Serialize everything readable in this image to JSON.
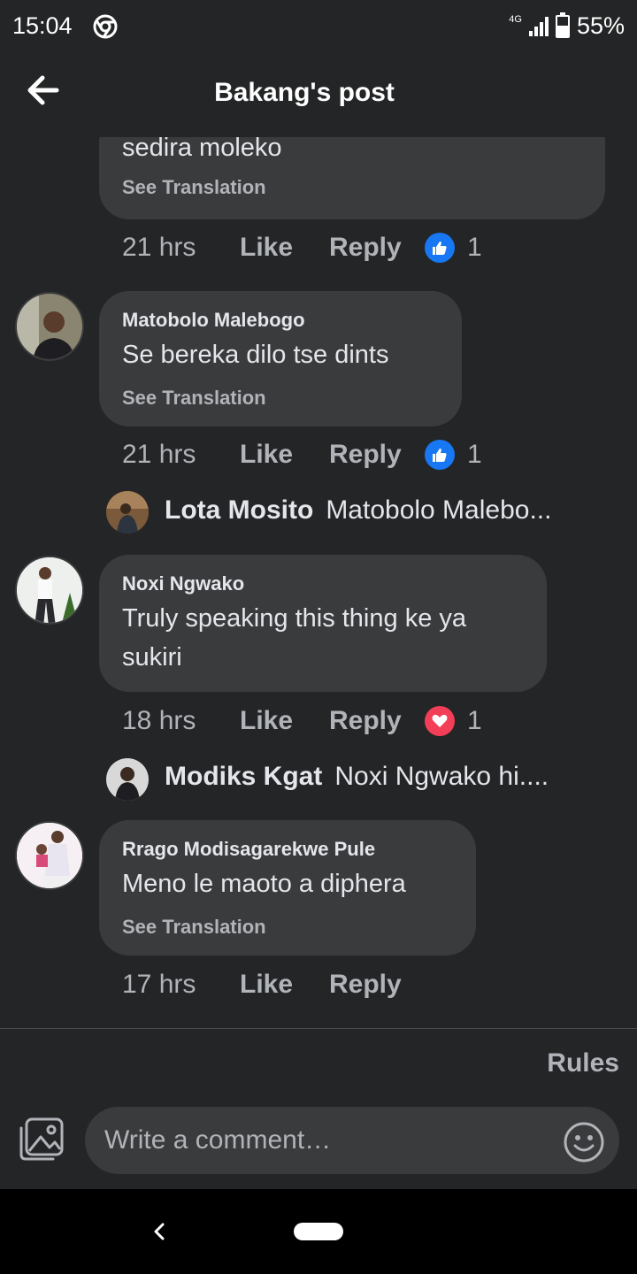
{
  "status_bar": {
    "time": "15:04",
    "network": "4G",
    "battery": "55%"
  },
  "header": {
    "title": "Bakang's post"
  },
  "comments": [
    {
      "name": "",
      "text": "sedira moleko",
      "see_translation": "See Translation",
      "time": "21 hrs",
      "like": "Like",
      "reply": "Reply",
      "reaction": "like",
      "reaction_count": "1"
    },
    {
      "name": "Matobolo Malebogo",
      "text": "Se bereka dilo tse dints",
      "see_translation": "See Translation",
      "time": "21 hrs",
      "like": "Like",
      "reply": "Reply",
      "reaction": "like",
      "reaction_count": "1",
      "reply_preview": {
        "name": "Lota Mosito",
        "text": "Matobolo Malebo..."
      }
    },
    {
      "name": "Noxi Ngwako",
      "text": "Truly speaking this thing ke ya sukiri",
      "time": "18 hrs",
      "like": "Like",
      "reply": "Reply",
      "reaction": "love",
      "reaction_count": "1",
      "reply_preview": {
        "name": "Modiks Kgat",
        "text": "Noxi Ngwako hi...."
      }
    },
    {
      "name": "Rrago Modisagarekwe Pule",
      "text": "Meno le maoto a diphera",
      "see_translation": "See Translation",
      "time": "17 hrs",
      "like": "Like",
      "reply": "Reply"
    }
  ],
  "composer": {
    "rules": "Rules",
    "placeholder": "Write a comment…"
  },
  "icons": {
    "back": "arrow-left-icon",
    "photo": "photo-icon",
    "emoji": "emoji-icon",
    "like_reaction": "thumbs-up-icon",
    "love_reaction": "heart-icon"
  },
  "colors": {
    "background": "#242526",
    "bubble": "#3a3b3c",
    "text": "#e4e6eb",
    "muted": "#b0b3b8",
    "like_blue": "#1877f2",
    "love_red": "#f33e58"
  }
}
